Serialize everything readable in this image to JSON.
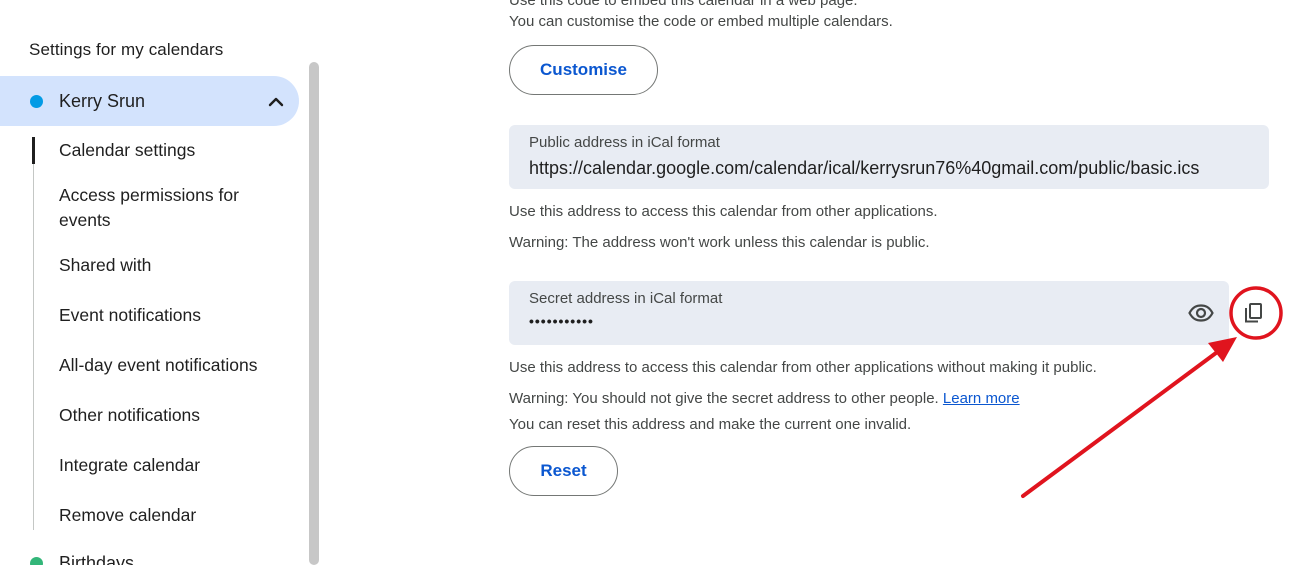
{
  "sidebar": {
    "heading": "Settings for my calendars",
    "calendar": {
      "name": "Kerry Srun",
      "color": "#039be5",
      "expanded": true
    },
    "items": [
      {
        "label": "Calendar settings",
        "active": true
      },
      {
        "label": "Access permissions for events"
      },
      {
        "label": "Shared with"
      },
      {
        "label": "Event notifications"
      },
      {
        "label": "All-day event notifications"
      },
      {
        "label": "Other notifications"
      },
      {
        "label": "Integrate calendar"
      },
      {
        "label": "Remove calendar"
      }
    ],
    "next_calendar": {
      "name": "Birthdays",
      "color": "#33b679"
    }
  },
  "main": {
    "embed_cut_text": "Use this code to embed this calendar in a web page.",
    "embed_help": "You can customise the code or embed multiple calendars.",
    "customise_button": "Customise",
    "public_ical": {
      "label": "Public address in iCal format",
      "value": "https://calendar.google.com/calendar/ical/kerrysrun76%40gmail.com/public/basic.ics",
      "help1": "Use this address to access this calendar from other applications.",
      "help2": "Warning: The address won't work unless this calendar is public."
    },
    "secret_ical": {
      "label": "Secret address in iCal format",
      "masked_value": "•••••••••••",
      "help1": "Use this address to access this calendar from other applications without making it public.",
      "warning": "Warning: You should not give the secret address to other people.",
      "learn_more": "Learn more",
      "reset_help": "You can reset this address and make the current one invalid.",
      "show_icon": "eye-icon",
      "copy_icon": "copy-icon"
    },
    "reset_button": "Reset"
  },
  "annotation": {
    "color": "#e0141e"
  }
}
